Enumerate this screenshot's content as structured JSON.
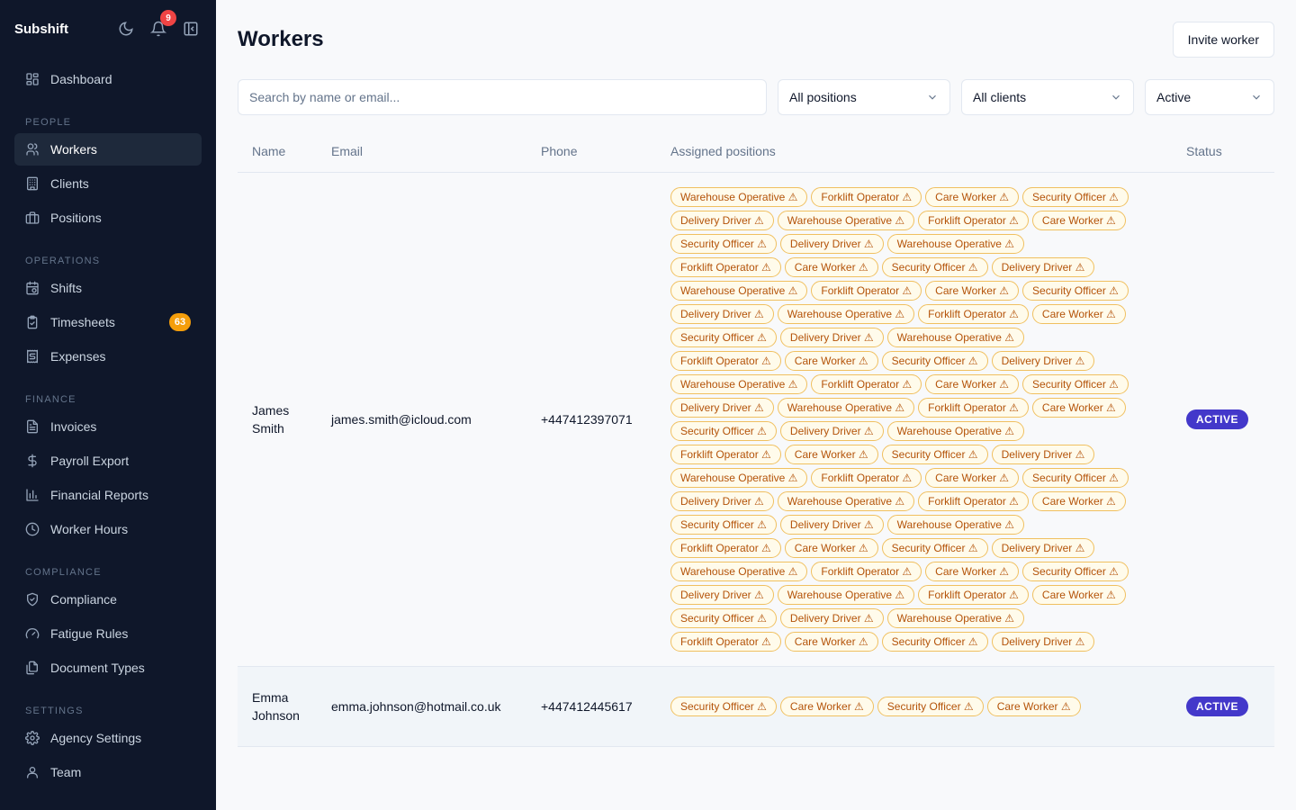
{
  "app": {
    "name": "Subshift",
    "notification_count": "9"
  },
  "sidebar": {
    "top": [
      {
        "label": "Dashboard",
        "icon": "dashboard-icon"
      }
    ],
    "sections": [
      {
        "title": "PEOPLE",
        "items": [
          {
            "label": "Workers",
            "icon": "users-icon",
            "active": true
          },
          {
            "label": "Clients",
            "icon": "building-icon"
          },
          {
            "label": "Positions",
            "icon": "briefcase-icon"
          }
        ]
      },
      {
        "title": "OPERATIONS",
        "items": [
          {
            "label": "Shifts",
            "icon": "calendar-clock-icon"
          },
          {
            "label": "Timesheets",
            "icon": "clipboard-check-icon",
            "badge": "63"
          },
          {
            "label": "Expenses",
            "icon": "receipt-icon"
          }
        ]
      },
      {
        "title": "FINANCE",
        "items": [
          {
            "label": "Invoices",
            "icon": "file-text-icon"
          },
          {
            "label": "Payroll Export",
            "icon": "dollar-icon"
          },
          {
            "label": "Financial Reports",
            "icon": "bar-chart-icon"
          },
          {
            "label": "Worker Hours",
            "icon": "clock-icon"
          }
        ]
      },
      {
        "title": "COMPLIANCE",
        "items": [
          {
            "label": "Compliance",
            "icon": "shield-check-icon"
          },
          {
            "label": "Fatigue Rules",
            "icon": "gauge-icon"
          },
          {
            "label": "Document Types",
            "icon": "files-icon"
          }
        ]
      },
      {
        "title": "SETTINGS",
        "items": [
          {
            "label": "Agency Settings",
            "icon": "gear-icon"
          },
          {
            "label": "Team",
            "icon": "user-icon"
          }
        ]
      }
    ]
  },
  "header": {
    "title": "Workers",
    "invite_label": "Invite worker"
  },
  "filters": {
    "search_placeholder": "Search by name or email...",
    "positions": "All positions",
    "clients": "All clients",
    "status": "Active"
  },
  "table": {
    "columns": [
      "Name",
      "Email",
      "Phone",
      "Assigned positions",
      "Status"
    ],
    "rows": [
      {
        "name": "James Smith",
        "email": "james.smith@icloud.com",
        "phone": "+447412397071",
        "status": "ACTIVE",
        "positions": [
          "Warehouse Operative ⚠",
          "Forklift Operator ⚠",
          "Care Worker ⚠",
          "Security Officer ⚠",
          "Delivery Driver ⚠",
          "Warehouse Operative ⚠",
          "Forklift Operator ⚠",
          "Care Worker ⚠",
          "Security Officer ⚠",
          "Delivery Driver ⚠",
          "Warehouse Operative ⚠",
          "Forklift Operator ⚠",
          "Care Worker ⚠",
          "Security Officer ⚠",
          "Delivery Driver ⚠",
          "Warehouse Operative ⚠",
          "Forklift Operator ⚠",
          "Care Worker ⚠",
          "Security Officer ⚠",
          "Delivery Driver ⚠",
          "Warehouse Operative ⚠",
          "Forklift Operator ⚠",
          "Care Worker ⚠",
          "Security Officer ⚠",
          "Delivery Driver ⚠",
          "Warehouse Operative ⚠",
          "Forklift Operator ⚠",
          "Care Worker ⚠",
          "Security Officer ⚠",
          "Delivery Driver ⚠",
          "Warehouse Operative ⚠",
          "Forklift Operator ⚠",
          "Care Worker ⚠",
          "Security Officer ⚠",
          "Delivery Driver ⚠",
          "Warehouse Operative ⚠",
          "Forklift Operator ⚠",
          "Care Worker ⚠",
          "Security Officer ⚠",
          "Delivery Driver ⚠",
          "Warehouse Operative ⚠",
          "Forklift Operator ⚠",
          "Care Worker ⚠",
          "Security Officer ⚠",
          "Delivery Driver ⚠",
          "Warehouse Operative ⚠",
          "Forklift Operator ⚠",
          "Care Worker ⚠",
          "Security Officer ⚠",
          "Delivery Driver ⚠",
          "Warehouse Operative ⚠",
          "Forklift Operator ⚠",
          "Care Worker ⚠",
          "Security Officer ⚠",
          "Delivery Driver ⚠",
          "Warehouse Operative ⚠",
          "Forklift Operator ⚠",
          "Care Worker ⚠",
          "Security Officer ⚠",
          "Delivery Driver ⚠",
          "Warehouse Operative ⚠",
          "Forklift Operator ⚠",
          "Care Worker ⚠",
          "Security Officer ⚠",
          "Delivery Driver ⚠",
          "Warehouse Operative ⚠",
          "Forklift Operator ⚠",
          "Care Worker ⚠",
          "Security Officer ⚠",
          "Delivery Driver ⚠",
          "Warehouse Operative ⚠",
          "Forklift Operator ⚠",
          "Care Worker ⚠",
          "Security Officer ⚠",
          "Delivery Driver ⚠"
        ]
      },
      {
        "name": "Emma Johnson",
        "email": "emma.johnson@hotmail.co.uk",
        "phone": "+447412445617",
        "status": "ACTIVE",
        "positions": [
          "Security Officer ⚠",
          "Care Worker ⚠",
          "Security Officer ⚠",
          "Care Worker ⚠"
        ]
      }
    ]
  },
  "colors": {
    "sidebar_bg": "#0f172a",
    "status_active": "#4338ca",
    "tag_warning": "#b45309",
    "timesheet_badge": "#f59e0b",
    "notification": "#ef4444"
  }
}
